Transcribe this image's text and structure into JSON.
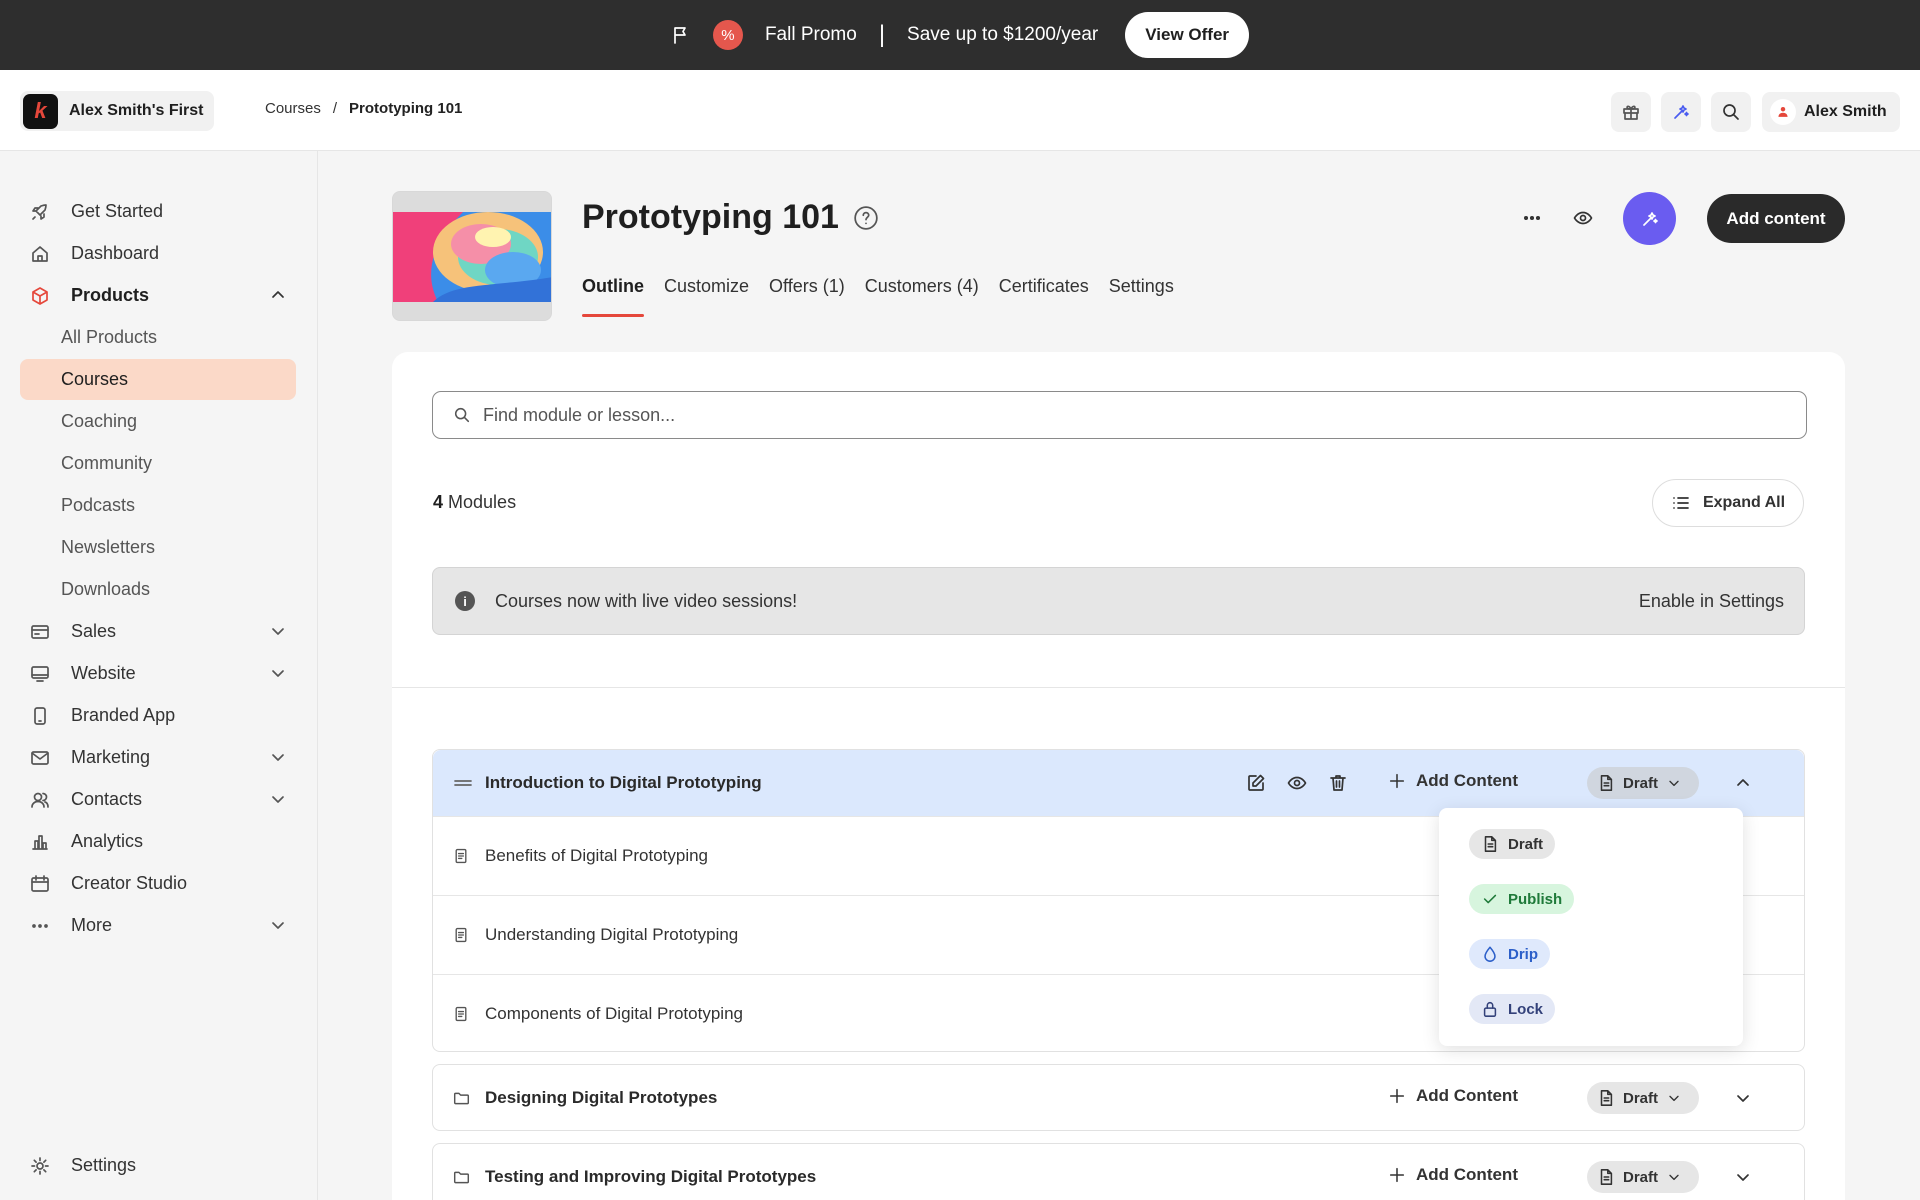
{
  "promo": {
    "percent_glyph": "%",
    "name": "Fall Promo",
    "separator": "|",
    "message": "Save up to $1200/year",
    "button": "View Offer"
  },
  "header": {
    "workspace_logo": "k",
    "workspace_name": "Alex Smith's First",
    "breadcrumb": [
      "Courses",
      "/",
      "Prototyping 101"
    ],
    "user_name": "Alex Smith"
  },
  "sidebar": {
    "items": [
      {
        "label": "Get Started",
        "icon": "rocket-icon"
      },
      {
        "label": "Dashboard",
        "icon": "home-icon"
      },
      {
        "label": "Products",
        "icon": "box-icon",
        "expanded": true
      },
      {
        "label": "All Products"
      },
      {
        "label": "Courses",
        "active": true
      },
      {
        "label": "Coaching"
      },
      {
        "label": "Community"
      },
      {
        "label": "Podcasts"
      },
      {
        "label": "Newsletters"
      },
      {
        "label": "Downloads"
      },
      {
        "label": "Sales",
        "icon": "card-icon"
      },
      {
        "label": "Website",
        "icon": "monitor-icon"
      },
      {
        "label": "Branded App",
        "icon": "phone-icon"
      },
      {
        "label": "Marketing",
        "icon": "mail-icon"
      },
      {
        "label": "Contacts",
        "icon": "users-icon"
      },
      {
        "label": "Analytics",
        "icon": "bar-chart-icon"
      },
      {
        "label": "Creator Studio",
        "icon": "calendar-icon"
      },
      {
        "label": "More",
        "icon": "dots-icon"
      }
    ],
    "settings": "Settings"
  },
  "product": {
    "title": "Prototyping 101",
    "tabs": [
      "Outline",
      "Customize",
      "Offers (1)",
      "Customers (4)",
      "Certificates",
      "Settings"
    ],
    "active_tab": "Outline",
    "add_content": "Add content"
  },
  "outline": {
    "search_placeholder": "Find module or lesson...",
    "module_count": "4",
    "module_count_label": "Modules",
    "expand_all": "Expand All",
    "banner_text": "Courses now with live video sessions!",
    "banner_link": "Enable in Settings",
    "modules": [
      {
        "title": "Introduction to Digital Prototyping",
        "add_content": "Add Content",
        "status": "Draft",
        "lessons": [
          "Benefits of Digital Prototyping",
          "Understanding Digital Prototyping",
          "Components of Digital Prototyping"
        ]
      },
      {
        "title": "Designing Digital Prototypes",
        "add_content": "Add Content",
        "status": "Draft"
      },
      {
        "title": "Testing and Improving Digital Prototypes",
        "add_content": "Add Content",
        "status": "Draft"
      }
    ]
  },
  "status_menu": {
    "options": [
      {
        "label": "Draft",
        "bg": "#e6e6e6",
        "fg": "#333333"
      },
      {
        "label": "Publish",
        "bg": "#d7f5de",
        "fg": "#1f7a3a"
      },
      {
        "label": "Drip",
        "bg": "#dfe9fc",
        "fg": "#2c5fc9"
      },
      {
        "label": "Lock",
        "bg": "#e3e8f6",
        "fg": "#33417a"
      }
    ]
  },
  "colors": {
    "accent": "#e5473b",
    "ai_button": "#6a5cf0",
    "active_nav": "#fbd9c8",
    "module_highlight": "#dbe8fd"
  }
}
